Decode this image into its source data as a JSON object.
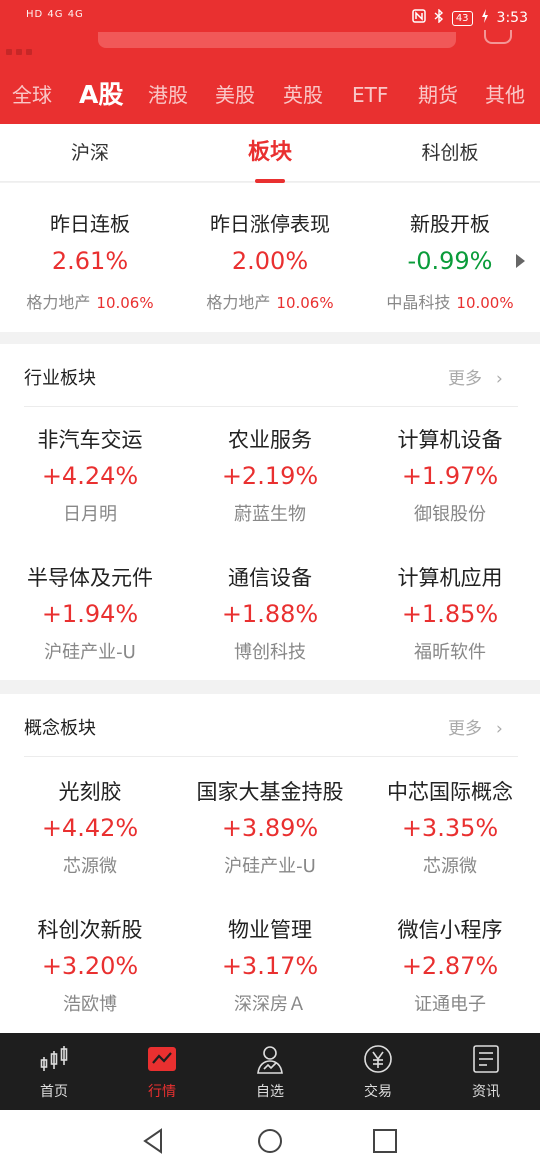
{
  "status": {
    "signal_left": "HD 4G 4G",
    "time": "3:53",
    "battery": "43",
    "icons": [
      "nfc-icon",
      "bluetooth-icon",
      "battery-icon",
      "charging-icon"
    ]
  },
  "market_tabs": [
    {
      "label": "全球"
    },
    {
      "label": "A股",
      "active": true
    },
    {
      "label": "港股"
    },
    {
      "label": "美股"
    },
    {
      "label": "英股"
    },
    {
      "label": "ETF"
    },
    {
      "label": "期货"
    },
    {
      "label": "其他"
    }
  ],
  "sub_tabs": [
    {
      "label": "沪深"
    },
    {
      "label": "板块",
      "active": true
    },
    {
      "label": "科创板"
    }
  ],
  "stats": [
    {
      "title": "昨日连板",
      "value": "2.61%",
      "stock": "格力地产",
      "pct": "10.06%"
    },
    {
      "title": "昨日涨停表现",
      "value": "2.00%",
      "stock": "格力地产",
      "pct": "10.06%"
    },
    {
      "title": "新股开板",
      "value": "-0.99%",
      "stock": "中晶科技",
      "pct": "10.00%"
    }
  ],
  "industry": {
    "title": "行业板块",
    "more": "更多",
    "items": [
      {
        "name": "非汽车交运",
        "change": "+4.24%",
        "leader": "日月明"
      },
      {
        "name": "农业服务",
        "change": "+2.19%",
        "leader": "蔚蓝生物"
      },
      {
        "name": "计算机设备",
        "change": "+1.97%",
        "leader": "御银股份"
      },
      {
        "name": "半导体及元件",
        "change": "+1.94%",
        "leader": "沪硅产业-U"
      },
      {
        "name": "通信设备",
        "change": "+1.88%",
        "leader": "博创科技"
      },
      {
        "name": "计算机应用",
        "change": "+1.85%",
        "leader": "福昕软件"
      }
    ]
  },
  "concept": {
    "title": "概念板块",
    "more": "更多",
    "items": [
      {
        "name": "光刻胶",
        "change": "+4.42%",
        "leader": "芯源微"
      },
      {
        "name": "国家大基金持股",
        "change": "+3.89%",
        "leader": "沪硅产业-U"
      },
      {
        "name": "中芯国际概念",
        "change": "+3.35%",
        "leader": "芯源微"
      },
      {
        "name": "科创次新股",
        "change": "+3.20%",
        "leader": "浩欧博"
      },
      {
        "name": "物业管理",
        "change": "+3.17%",
        "leader": "深深房Ａ"
      },
      {
        "name": "微信小程序",
        "change": "+2.87%",
        "leader": "证通电子"
      }
    ]
  },
  "bottom_nav": [
    {
      "label": "首页",
      "icon": "candlestick-icon"
    },
    {
      "label": "行情",
      "icon": "market-chart-icon",
      "active": true
    },
    {
      "label": "自选",
      "icon": "watchlist-user-icon"
    },
    {
      "label": "交易",
      "icon": "yen-coin-icon"
    },
    {
      "label": "资讯",
      "icon": "news-document-icon"
    }
  ],
  "colors": {
    "accent": "#e93030",
    "down": "#0a9c3a",
    "nav_bg": "#1e1e1e"
  }
}
